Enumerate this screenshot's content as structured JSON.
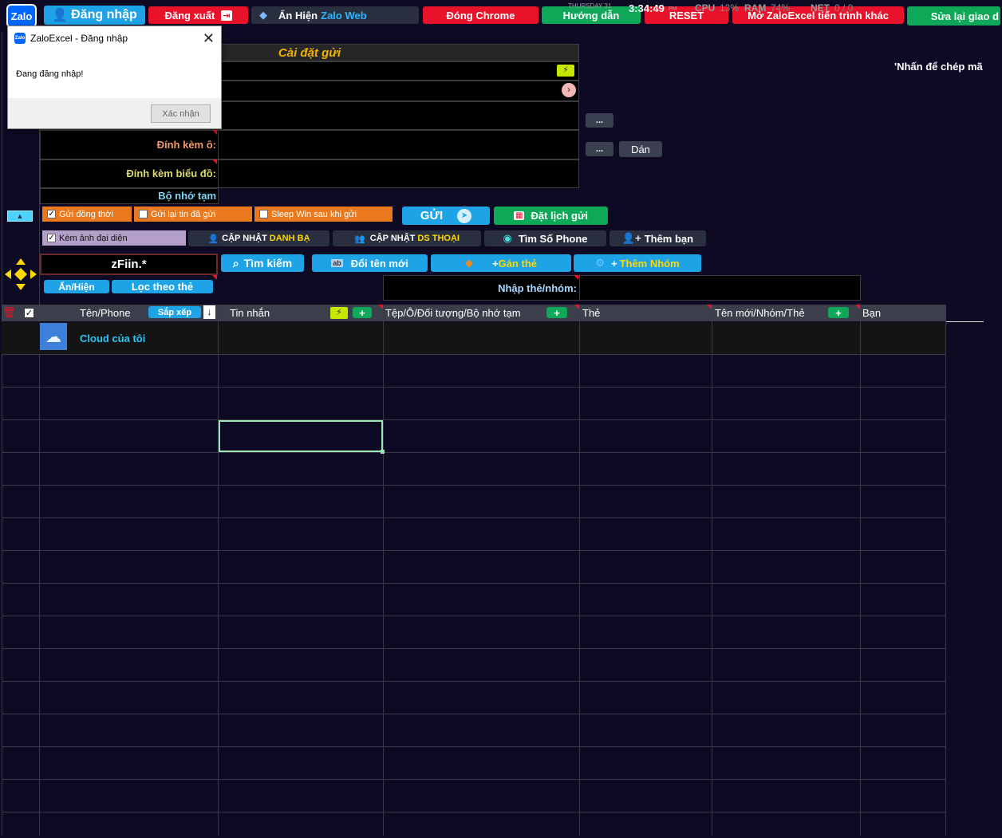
{
  "toolbar": {
    "login": "Đăng nhập",
    "logout": "Đăng xuất",
    "show_hide_prefix": "Ẩn Hiện",
    "show_hide_zalo": "Zalo Web",
    "close_chrome": "Đóng Chrome",
    "guide": "Hướng dẫn",
    "reset": "RESET",
    "open_other": "Mở ZaloExcel tiến trình khác",
    "fix_ui": "Sửa lại giao d",
    "logo": "Zalo"
  },
  "status": {
    "day": "THURSDAY 31",
    "time": "3:34:49",
    "ampm": "PM",
    "cpu_label": "CPU",
    "cpu_value": "13%",
    "ram_label": "RAM",
    "ram_value": "74%",
    "net_label": "NET",
    "net_value": "0 / 0"
  },
  "dialog": {
    "title": "ZaloExcel - Đăng nhập",
    "message": "Đang đăng nhập!",
    "ok": "Xác nhận"
  },
  "settings": {
    "header": "Cài đặt gửi",
    "attach_cell": "Đính kèm ô:",
    "attach_chart": "Đính kèm biểu đồ:",
    "temp_memory": "Bộ nhớ tạm",
    "copy_hint": "'Nhấn để chép mã",
    "dots1": "...",
    "dots2": "...",
    "paste": "Dán"
  },
  "options": {
    "send_simultaneous": "Gửi đồng thời",
    "resend_sent": "Gửi lại tin đã gửi",
    "sleep_win": "Sleep Win sau khi gửi",
    "attach_avatar": "Kèm ảnh đại diện",
    "send": "GỬI",
    "schedule": "Đặt lịch gửi",
    "update_contacts_prefix": "CẬP NHẬT",
    "update_contacts_suffix": "DANH BẠ",
    "update_phones_prefix": "CẬP NHẬT",
    "update_phones_suffix": "DS THOẠI",
    "find_phone": "Tìm Số Phone",
    "add_friend": "Thêm bạn"
  },
  "search": {
    "value": "zFiin.*",
    "search": "Tìm kiếm",
    "rename": "Đổi tên mới",
    "assign_tag_prefix": "+",
    "assign_tag": "Gán thẻ",
    "add_group_prefix": "+",
    "add_group": "Thêm Nhóm",
    "show_hide": "Ẩn/Hiện",
    "filter_tag": "Lọc theo thẻ",
    "tag_input_label": "Nhập thẻ/nhóm:"
  },
  "table": {
    "col_name": "Tên/Phone",
    "sort": "Sắp xếp",
    "col_message": "Tin nhắn",
    "col_files": "Tệp/Ô/Đối tượng/Bộ nhớ tạm",
    "col_tag": "Thẻ",
    "col_newname": "Tên mới/Nhóm/Thẻ",
    "col_friend": "Bạn",
    "plus": "+",
    "row1_name": "Cloud của tôi"
  },
  "colors": {
    "bg": "#0e0a24",
    "red": "#e8132a",
    "green": "#0fa858",
    "blue": "#1da3e6",
    "orange": "#e9791c",
    "yellow": "#ffd800"
  }
}
